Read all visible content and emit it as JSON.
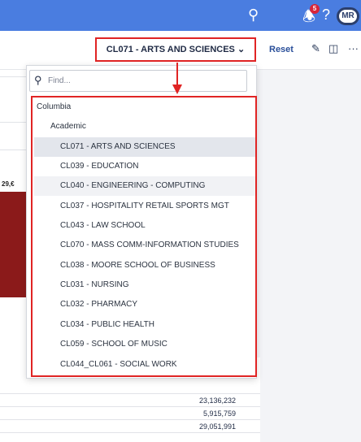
{
  "topbar": {
    "notification_count": "5",
    "avatar_initials": "MR"
  },
  "toolbar": {
    "selector_label": "CL071 - ARTS AND SCIENCES",
    "reset_label": "Reset"
  },
  "background": {
    "bar_value_label": "29,€",
    "table_values": [
      "23,136,232",
      "5,915,759",
      "29,051,991"
    ]
  },
  "dropdown": {
    "search_placeholder": "Find...",
    "root": "Columbia",
    "group": "Academic",
    "items": [
      "CL071 - ARTS AND SCIENCES",
      "CL039 - EDUCATION",
      "CL040 - ENGINEERING - COMPUTING",
      "CL037 - HOSPITALITY RETAIL SPORTS MGT",
      "CL043 - LAW SCHOOL",
      "CL070 - MASS COMM-INFORMATION STUDIES",
      "CL038 - MOORE SCHOOL OF BUSINESS",
      "CL031 - NURSING",
      "CL032 - PHARMACY",
      "CL034 - PUBLIC HEALTH",
      "CL059 - SCHOOL OF MUSIC",
      "CL044_CL061 - SOCIAL WORK"
    ],
    "selected_index": 0
  },
  "colors": {
    "topbar": "#4a7de0",
    "highlight": "#e02424",
    "bar": "#8b1a1a"
  }
}
